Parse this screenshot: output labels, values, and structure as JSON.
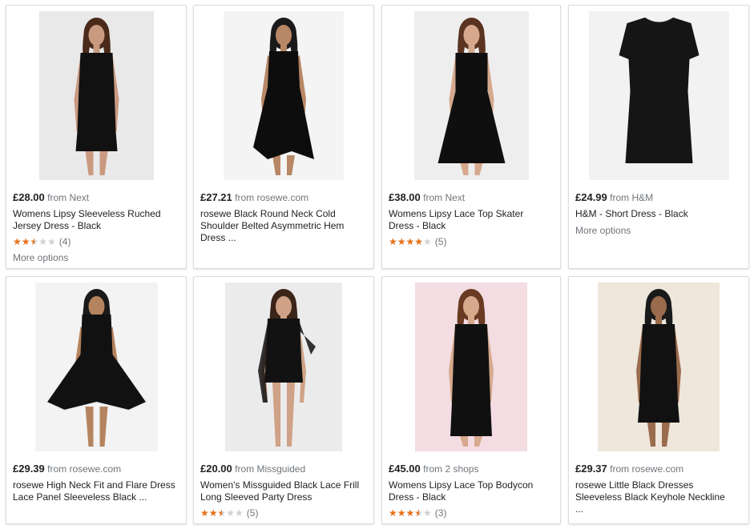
{
  "products": [
    {
      "price": "£28.00",
      "source": "from Next",
      "title": "Womens Lipsy Sleeveless Ruched Jersey Dress - Black",
      "rating_value": 2.5,
      "rating_count": "(4)",
      "more_options": "More options",
      "image": {
        "bg": "#e9e9e9",
        "dress_color": "#111111",
        "skin": "#c99a80",
        "hair": "#4a2a1a",
        "style": "sheath"
      }
    },
    {
      "price": "£27.21",
      "source": "from rosewe.com",
      "title": "rosewe Black Round Neck Cold Shoulder Belted Asymmetric Hem Dress ...",
      "image": {
        "bg": "#f4f4f4",
        "dress_color": "#0d0d0d",
        "skin": "#b88766",
        "hair": "#1a1a1a",
        "style": "longhem"
      }
    },
    {
      "price": "£38.00",
      "source": "from Next",
      "title": "Womens Lipsy Lace Top Skater Dress - Black",
      "rating_value": 4.0,
      "rating_count": "(5)",
      "image": {
        "bg": "#eeeeee",
        "dress_color": "#0f0f0f",
        "skin": "#d6a98e",
        "hair": "#5a3420",
        "style": "skater"
      }
    },
    {
      "price": "£24.99",
      "source": "from H&M",
      "title": "H&M - Short Dress - Black",
      "more_options": "More options",
      "image": {
        "bg": "#f2f2f2",
        "dress_color": "#151515",
        "style": "flat"
      }
    },
    {
      "price": "£29.39",
      "source": "from rosewe.com",
      "title": "rosewe High Neck Fit and Flare Dress Lace Panel Sleeveless Black ...",
      "image": {
        "bg": "#f3f3f3",
        "dress_color": "#111111",
        "skin": "#b5845f",
        "hair": "#1a1a1a",
        "style": "flare"
      }
    },
    {
      "price": "£20.00",
      "source": "from Missguided",
      "title": "Women's Missguided Black Lace Frill Long Sleeved Party Dress",
      "rating_value": 2.5,
      "rating_count": "(5)",
      "image": {
        "bg": "#ebebeb",
        "dress_color": "#121212",
        "skin": "#cfa186",
        "hair": "#3b2418",
        "style": "longsleeve"
      }
    },
    {
      "price": "£45.00",
      "source": "from 2 shops",
      "title": "Womens Lipsy Lace Top Bodycon Dress - Black",
      "rating_value": 3.5,
      "rating_count": "(3)",
      "image": {
        "bg": "#f3dde2",
        "dress_color": "#101010",
        "skin": "#d7a98d",
        "hair": "#6a3b22",
        "style": "bodycon"
      }
    },
    {
      "price": "£29.37",
      "source": "from rosewe.com",
      "title": "rosewe Little Black Dresses Sleeveless Black Keyhole Neckline ...",
      "image": {
        "bg": "#efe6dc",
        "dress_color": "#111111",
        "skin": "#9a6b4c",
        "hair": "#1a1a1a",
        "style": "keyhole"
      }
    }
  ],
  "colors": {
    "star_filled": "#e7711b",
    "star_empty": "#d0d0d0",
    "muted_text": "#70757a"
  }
}
